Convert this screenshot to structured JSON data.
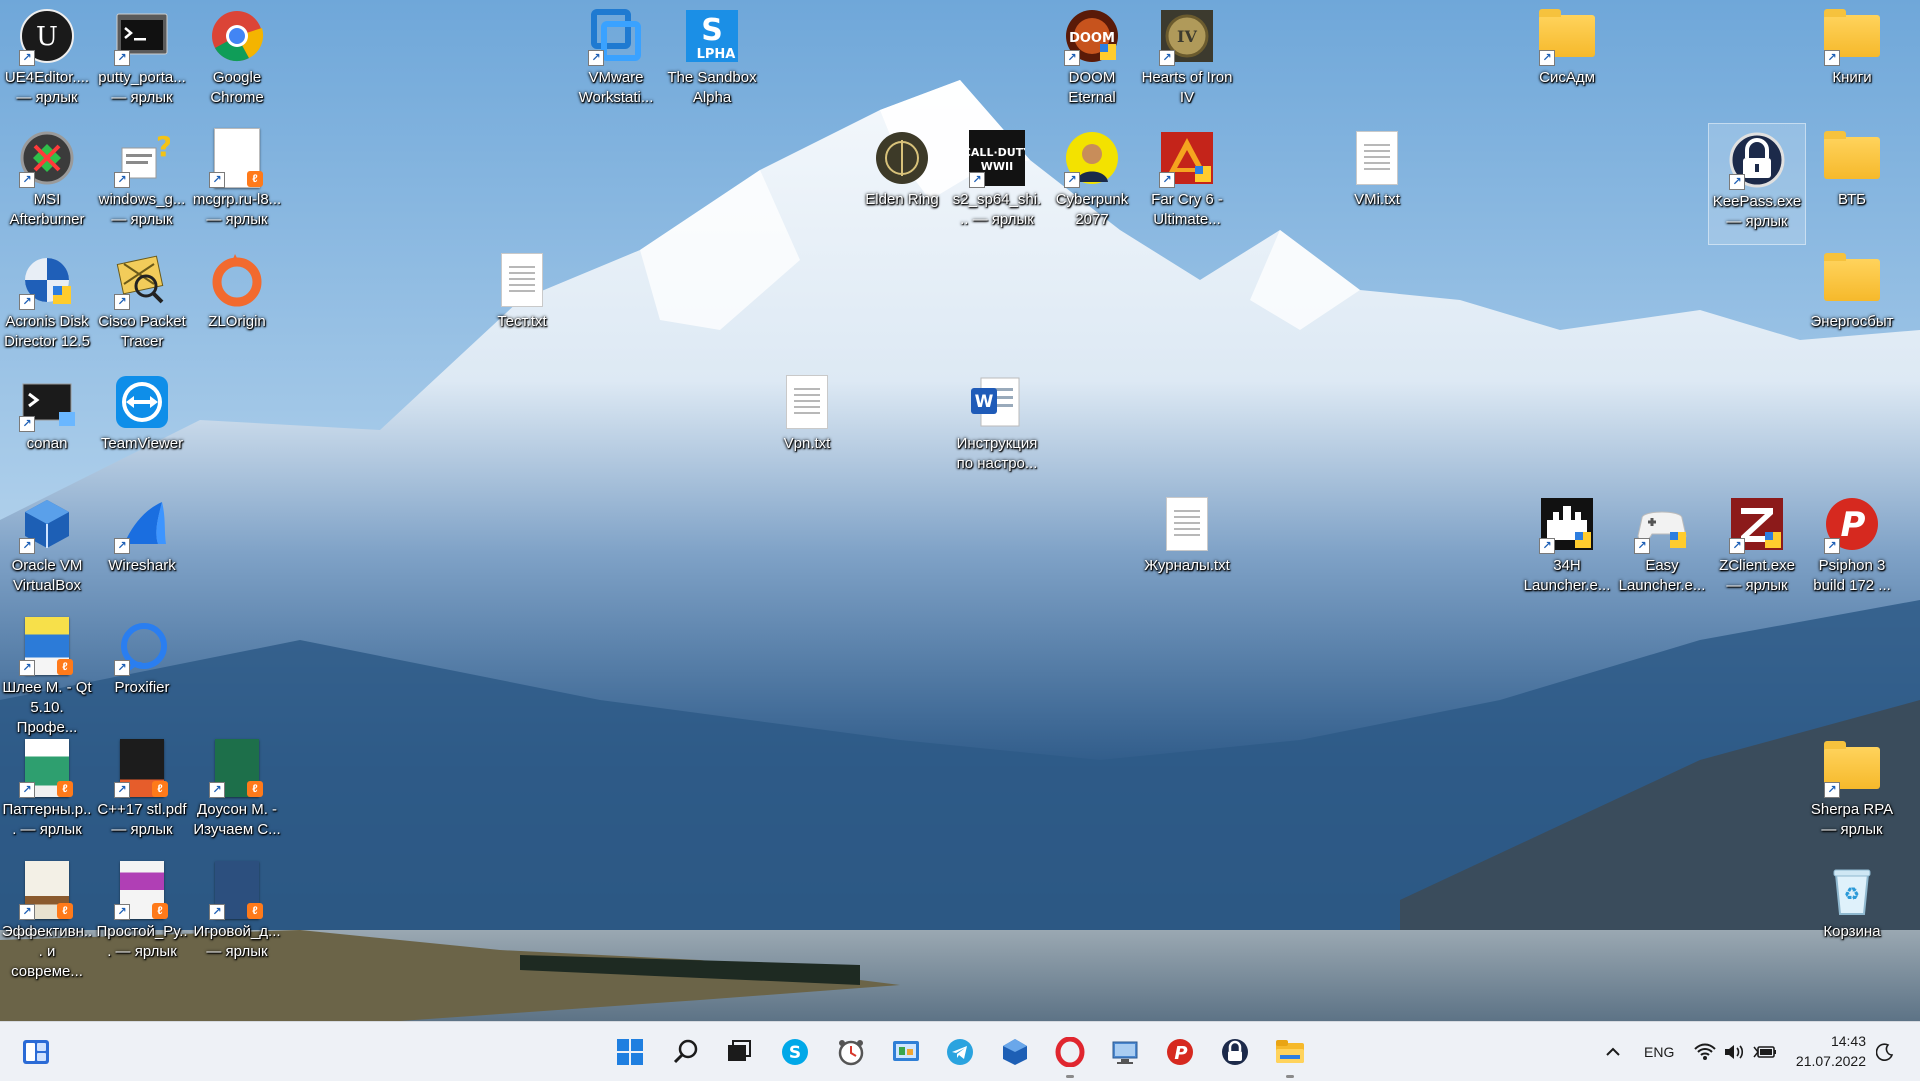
{
  "desktop": {
    "icons": [
      {
        "label": "UE4Editor.... — ярлык",
        "icon": "unreal-engine-icon"
      },
      {
        "label": "putty_porta... — ярлык",
        "icon": "putty-terminal-icon"
      },
      {
        "label": "Google Chrome",
        "icon": "chrome-icon"
      },
      {
        "label": "VMware Workstati...",
        "icon": "vmware-icon"
      },
      {
        "label": "The Sandbox Alpha",
        "icon": "sandbox-alpha-icon"
      },
      {
        "label": "DOOM Eternal",
        "icon": "doom-eternal-icon"
      },
      {
        "label": "Hearts of Iron IV",
        "icon": "hearts-of-iron-icon"
      },
      {
        "label": "СисАдм",
        "icon": "folder-icon"
      },
      {
        "label": "Книги",
        "icon": "folder-icon"
      },
      {
        "label": "MSI Afterburner",
        "icon": "msi-afterburner-icon"
      },
      {
        "label": "windows_g... — ярлык",
        "icon": "windows-script-icon"
      },
      {
        "label": "mcgrp.ru-l8... — ярлык",
        "icon": "pdf-document-icon"
      },
      {
        "label": "Elden Ring",
        "icon": "elden-ring-icon"
      },
      {
        "label": "s2_sp64_shi... — ярлык",
        "icon": "call-of-duty-icon"
      },
      {
        "label": "Cyberpunk 2077",
        "icon": "cyberpunk-icon"
      },
      {
        "label": "Far Cry 6 - Ultimate...",
        "icon": "far-cry-icon"
      },
      {
        "label": "VMi.txt",
        "icon": "text-file-icon"
      },
      {
        "label": "KeePass.exe — ярлык",
        "icon": "keepass-icon"
      },
      {
        "label": "ВТБ",
        "icon": "folder-icon"
      },
      {
        "label": "Acronis Disk Director 12.5",
        "icon": "acronis-icon"
      },
      {
        "label": "Cisco Packet Tracer",
        "icon": "cisco-packet-tracer-icon"
      },
      {
        "label": "ZLOrigin",
        "icon": "origin-icon"
      },
      {
        "label": "Тест.txt",
        "icon": "text-file-icon"
      },
      {
        "label": "Энергосбыт",
        "icon": "folder-icon"
      },
      {
        "label": "conan",
        "icon": "terminal-icon"
      },
      {
        "label": "TeamViewer",
        "icon": "teamviewer-icon"
      },
      {
        "label": "Vpn.txt",
        "icon": "text-file-icon"
      },
      {
        "label": "Инструкция по настро...",
        "icon": "word-document-icon"
      },
      {
        "label": "Oracle VM VirtualBox",
        "icon": "virtualbox-icon"
      },
      {
        "label": "Wireshark",
        "icon": "wireshark-icon"
      },
      {
        "label": "Журналы.txt",
        "icon": "text-file-icon"
      },
      {
        "label": "34H Launcher.e...",
        "icon": "launcher-icon"
      },
      {
        "label": "Easy Launcher.e...",
        "icon": "gamepad-icon"
      },
      {
        "label": "ZClient.exe — ярлык",
        "icon": "zclient-icon"
      },
      {
        "label": "Psiphon 3 build 172 ...",
        "icon": "psiphon-icon"
      },
      {
        "label": "Шлее М. - Qt 5.10. Профе...",
        "icon": "book-pdf-icon"
      },
      {
        "label": "Proxifier",
        "icon": "proxifier-icon"
      },
      {
        "label": "Паттерны.p... — ярлык",
        "icon": "book-pdf-icon"
      },
      {
        "label": "C++17 stl.pdf — ярлык",
        "icon": "book-pdf-icon"
      },
      {
        "label": "Доусон М. - Изучаем С...",
        "icon": "book-pdf-icon"
      },
      {
        "label": "Sherpa RPA — ярлык",
        "icon": "folder-icon"
      },
      {
        "label": "Эффективн... и совреме...",
        "icon": "book-pdf-icon"
      },
      {
        "label": "Простой_Ру... — ярлык",
        "icon": "book-pdf-icon"
      },
      {
        "label": "Игровой_д... — ярлык",
        "icon": "book-pdf-icon"
      },
      {
        "label": "Корзина",
        "icon": "recycle-bin-icon"
      }
    ]
  },
  "taskbar": {
    "widgets_icon": "widgets-icon",
    "pinned": [
      {
        "name": "start-button",
        "icon": "windows-start-icon"
      },
      {
        "name": "search-button",
        "icon": "search-icon"
      },
      {
        "name": "task-view-button",
        "icon": "task-view-icon"
      },
      {
        "name": "skype-button",
        "icon": "skype-icon"
      },
      {
        "name": "clock-app-button",
        "icon": "alarm-clock-icon"
      },
      {
        "name": "control-panel-button",
        "icon": "control-panel-icon"
      },
      {
        "name": "telegram-button",
        "icon": "telegram-icon"
      },
      {
        "name": "virtualbox-button",
        "icon": "virtualbox-icon"
      },
      {
        "name": "opera-button",
        "icon": "opera-icon"
      },
      {
        "name": "remote-desktop-button",
        "icon": "remote-desktop-icon"
      },
      {
        "name": "psiphon-button",
        "icon": "psiphon-icon"
      },
      {
        "name": "keepass-button",
        "icon": "keepass-icon"
      },
      {
        "name": "file-explorer-button",
        "icon": "file-explorer-icon"
      }
    ],
    "tray": {
      "chevron_icon": "chevron-up-icon",
      "language": "ENG",
      "network_icon": "wifi-icon",
      "volume_icon": "volume-icon",
      "battery_icon": "battery-icon",
      "time": "14:43",
      "date": "21.07.2022",
      "notification_icon": "moon-icon"
    }
  }
}
